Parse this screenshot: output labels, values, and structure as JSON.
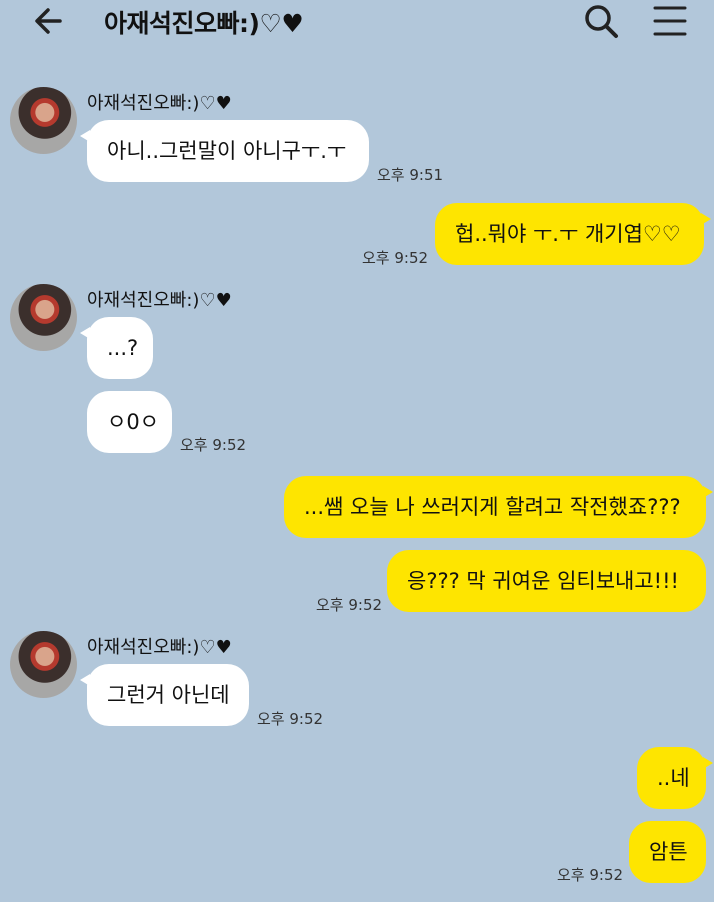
{
  "header": {
    "title": "아재석진오빠:)♡♥",
    "back_icon": "arrow-left-icon",
    "search_icon": "search-icon",
    "menu_icon": "hamburger-menu-icon"
  },
  "colors": {
    "background": "#b2c7da",
    "incoming_bubble": "#ffffff",
    "outgoing_bubble": "#fee500"
  },
  "messages": [
    {
      "sender": "아재석진오빠:)♡♥",
      "direction": "in",
      "text": "아니..그런말이 아니구ㅜ.ㅜ",
      "time": "오후 9:51"
    },
    {
      "direction": "out",
      "text": "헙..뭐야 ㅜ.ㅜ 개기엽♡♡",
      "time": "오후 9:52"
    },
    {
      "sender": "아재석진오빠:)♡♥",
      "direction": "in",
      "text": "...?"
    },
    {
      "direction": "in",
      "text": "ㅇ0ㅇ",
      "time": "오후 9:52"
    },
    {
      "direction": "out",
      "text": "...쌤 오늘 나 쓰러지게 할려고 작전했죠???"
    },
    {
      "direction": "out",
      "text": "응??? 막 귀여운 임티보내고!!!",
      "time": "오후 9:52"
    },
    {
      "sender": "아재석진오빠:)♡♥",
      "direction": "in",
      "text": "그런거 아닌데",
      "time": "오후 9:52"
    },
    {
      "direction": "out",
      "text": "..네"
    },
    {
      "direction": "out",
      "text": "암튼",
      "time": "오후 9:52"
    }
  ]
}
